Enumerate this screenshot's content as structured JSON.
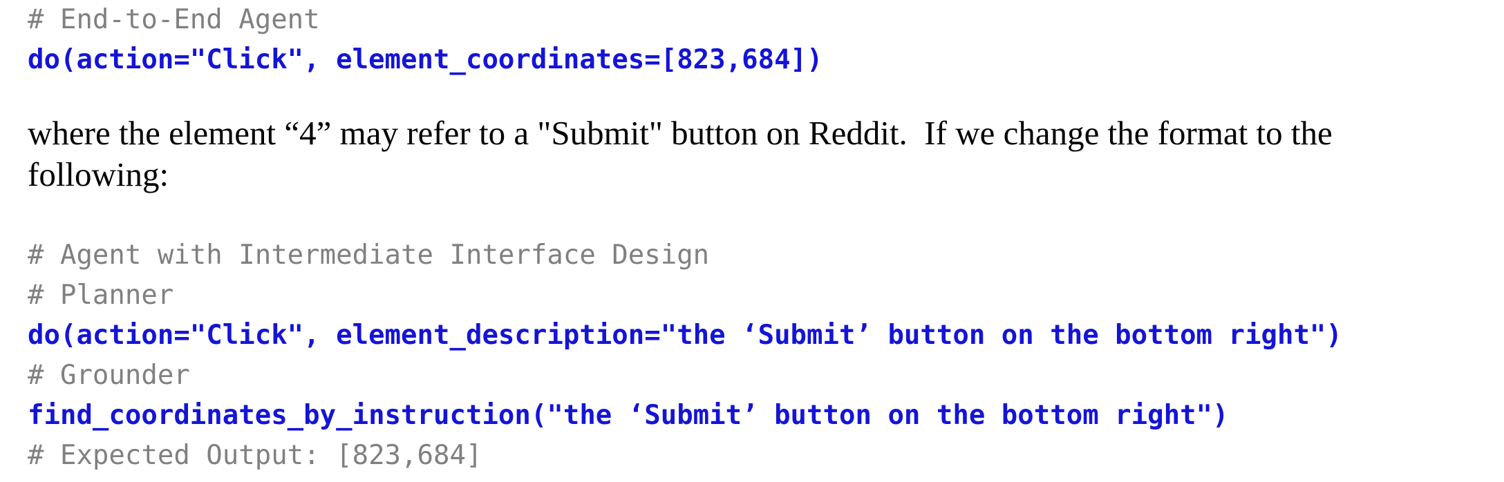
{
  "block_one": {
    "comment": "# End-to-End Agent",
    "code": "do(action=\"Click\", element_coordinates=[823,684])"
  },
  "paragraph": {
    "line1": "where the element “4” may refer to a \"Submit\" button on Reddit.  If we change the format to the",
    "line2": "following:"
  },
  "block_two": {
    "comment_title": "# Agent with Intermediate Interface Design",
    "comment_planner": "# Planner",
    "code_planner": "do(action=\"Click\", element_description=\"the ‘Submit’ button on the bottom right\")",
    "comment_grounder": "# Grounder",
    "code_grounder": "find_coordinates_by_instruction(\"the ‘Submit’ button on the bottom right\")",
    "comment_expected": "# Expected Output: [823,684]"
  },
  "colors": {
    "comment": "#808080",
    "code": "#1414d8",
    "text": "#000000"
  }
}
